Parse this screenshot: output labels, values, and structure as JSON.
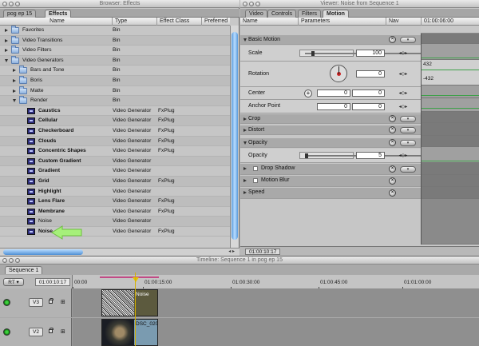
{
  "browser": {
    "title": "Browser: Effects",
    "tabs": [
      "pog ep 15",
      "Effects"
    ],
    "columns": [
      "Name",
      "Type",
      "Effect Class",
      "Preferred"
    ],
    "rows": [
      {
        "name": "Favorites",
        "type": "Bin",
        "cls": "",
        "indent": 0,
        "kind": "folder",
        "open": false
      },
      {
        "name": "Video Transitions",
        "type": "Bin",
        "cls": "",
        "indent": 0,
        "kind": "folder",
        "open": false
      },
      {
        "name": "Video Filters",
        "type": "Bin",
        "cls": "",
        "indent": 0,
        "kind": "folder",
        "open": false
      },
      {
        "name": "Video Generators",
        "type": "Bin",
        "cls": "",
        "indent": 0,
        "kind": "folder",
        "open": true
      },
      {
        "name": "Bars and Tone",
        "type": "Bin",
        "cls": "",
        "indent": 1,
        "kind": "folder",
        "open": false
      },
      {
        "name": "Boris",
        "type": "Bin",
        "cls": "",
        "indent": 1,
        "kind": "folder",
        "open": false
      },
      {
        "name": "Matte",
        "type": "Bin",
        "cls": "",
        "indent": 1,
        "kind": "folder",
        "open": false
      },
      {
        "name": "Render",
        "type": "Bin",
        "cls": "",
        "indent": 1,
        "kind": "folder",
        "open": true
      },
      {
        "name": "Caustics",
        "type": "Video Generator",
        "cls": "FxPlug",
        "indent": 2,
        "kind": "gen",
        "bold": true
      },
      {
        "name": "Cellular",
        "type": "Video Generator",
        "cls": "FxPlug",
        "indent": 2,
        "kind": "gen",
        "bold": true
      },
      {
        "name": "Checkerboard",
        "type": "Video Generator",
        "cls": "FxPlug",
        "indent": 2,
        "kind": "gen",
        "bold": true
      },
      {
        "name": "Clouds",
        "type": "Video Generator",
        "cls": "FxPlug",
        "indent": 2,
        "kind": "gen",
        "bold": true
      },
      {
        "name": "Concentric Shapes",
        "type": "Video Generator",
        "cls": "FxPlug",
        "indent": 2,
        "kind": "gen",
        "bold": true
      },
      {
        "name": "Custom Gradient",
        "type": "Video Generator",
        "cls": "",
        "indent": 2,
        "kind": "gen",
        "bold": true
      },
      {
        "name": "Gradient",
        "type": "Video Generator",
        "cls": "",
        "indent": 2,
        "kind": "gen",
        "bold": true
      },
      {
        "name": "Grid",
        "type": "Video Generator",
        "cls": "FxPlug",
        "indent": 2,
        "kind": "gen",
        "bold": true
      },
      {
        "name": "Highlight",
        "type": "Video Generator",
        "cls": "",
        "indent": 2,
        "kind": "gen",
        "bold": true
      },
      {
        "name": "Lens Flare",
        "type": "Video Generator",
        "cls": "FxPlug",
        "indent": 2,
        "kind": "gen",
        "bold": true
      },
      {
        "name": "Membrane",
        "type": "Video Generator",
        "cls": "FxPlug",
        "indent": 2,
        "kind": "gen",
        "bold": true
      },
      {
        "name": "Noise",
        "type": "Video Generator",
        "cls": "",
        "indent": 2,
        "kind": "gen",
        "bold": false
      },
      {
        "name": "Noise",
        "type": "Video Generator",
        "cls": "FxPlug",
        "indent": 2,
        "kind": "gen",
        "bold": true
      }
    ],
    "scroll_arrows": "◂ ▸"
  },
  "viewer": {
    "title": "Viewer: Noise from Sequence 1",
    "tabs": [
      "Video",
      "Controls",
      "Filters",
      "Motion"
    ],
    "columns": [
      "Name",
      "Parameters",
      "Nav"
    ],
    "timecode_header": "01:00:06:00",
    "sections": {
      "basic_motion": "Basic Motion",
      "crop": "Crop",
      "distort": "Distort",
      "opacity": "Opacity",
      "drop_shadow": "Drop Shadow",
      "motion_blur": "Motion Blur",
      "speed": "Speed"
    },
    "params": {
      "scale_label": "Scale",
      "scale_value": "100",
      "rotation_label": "Rotation",
      "rotation_value": "0",
      "center_label": "Center",
      "center_x": "0",
      "center_y": "0",
      "anchor_label": "Anchor Point",
      "anchor_x": "0",
      "anchor_y": "0",
      "opacity_label": "Opacity",
      "opacity_value": "5"
    },
    "keyframe_values": [
      "432",
      "-432"
    ],
    "footer_timecode": "01:00:10:17"
  },
  "timeline": {
    "title": "Timeline: Sequence 1 in pog ep 15",
    "tab": "Sequence 1",
    "rt_label": "RT ▾",
    "timecode": "01:00:10:17",
    "ruler": [
      "00:00",
      "01:00:15:00",
      "01:00:30:00",
      "01:00:45:00",
      "01:01:00:00"
    ],
    "tracks": [
      {
        "name": "V3",
        "clip": "Noise"
      },
      {
        "name": "V2",
        "clip": "DSC_020"
      }
    ]
  },
  "colors": {
    "accent_arrow": "#a6f07a",
    "render_bar": "#c24b86",
    "playhead": "#e6c400",
    "keyframe_line": "#3fa04a"
  }
}
